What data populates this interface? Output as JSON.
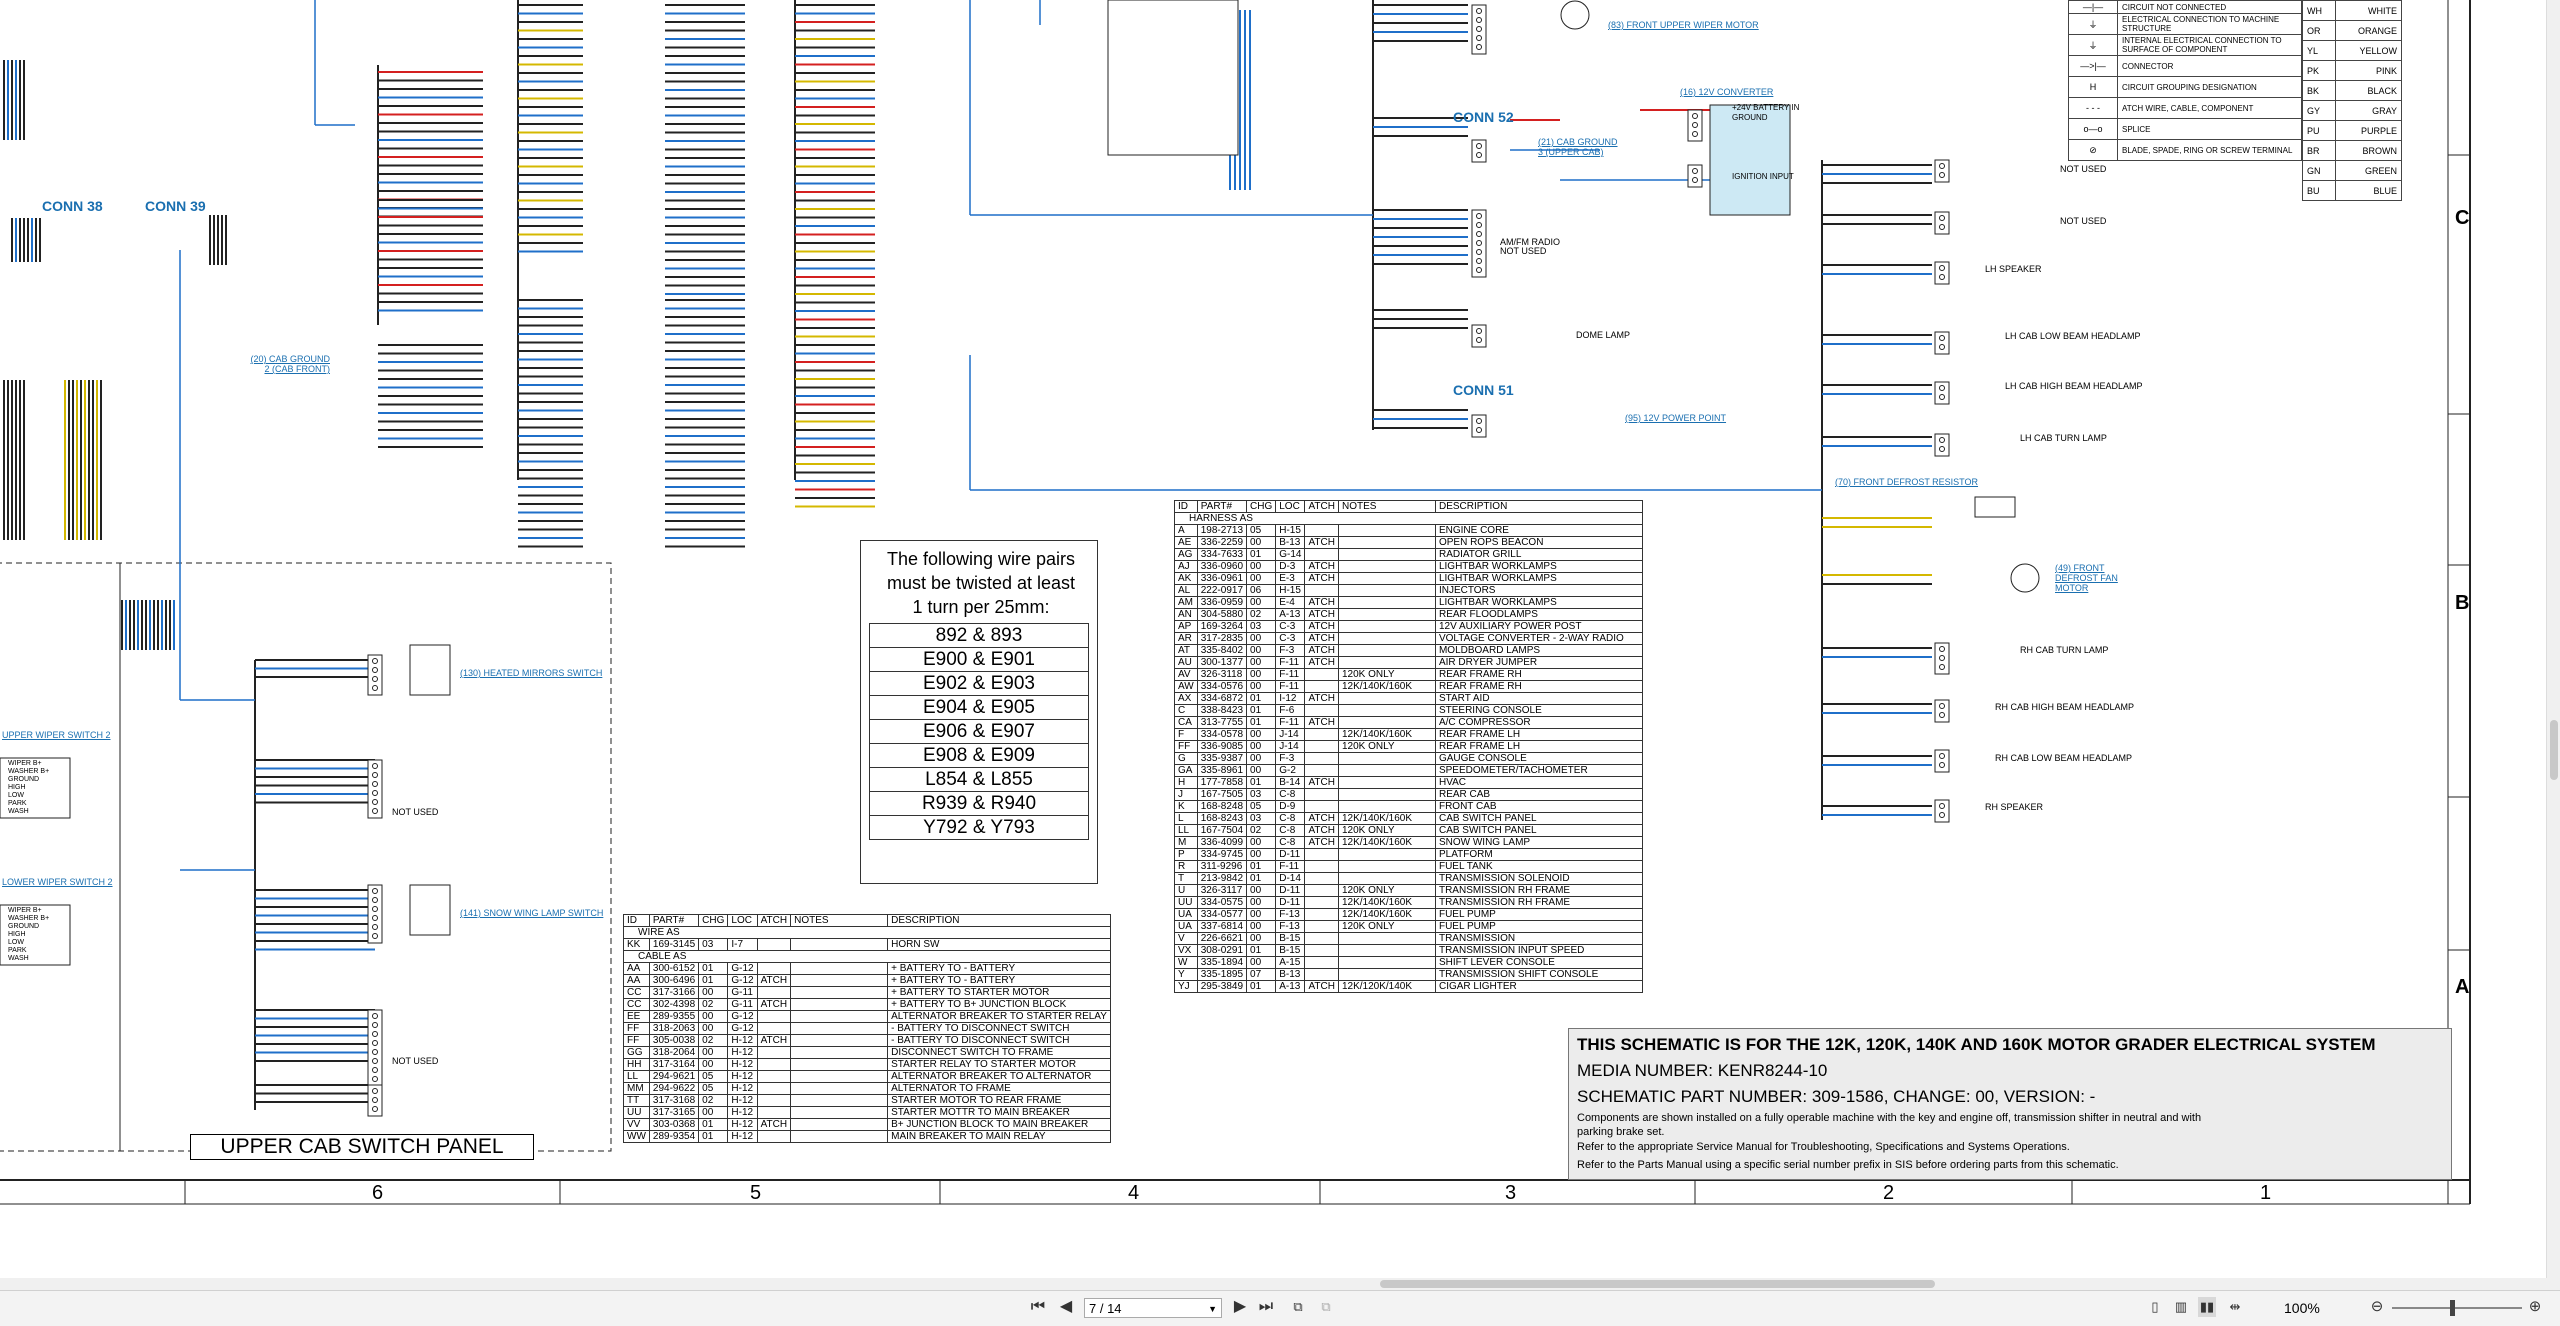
{
  "colors": {
    "wire_blue": "#1f6fc9",
    "wire_red": "#d42020",
    "wire_yellow": "#d4b800",
    "link": "#1a6fb0",
    "titleblock_bg": "#ececec",
    "wire_dark": "#222222"
  },
  "connectors": {
    "conn38": "CONN 38",
    "conn39": "CONN 39",
    "conn52": "CONN 52",
    "conn51": "CONN 51"
  },
  "component_links": {
    "front_upper_wiper": "(83) FRONT UPPER WIPER MOTOR",
    "cab_ground_2": "(20) CAB GROUND 2 (CAB FRONT)",
    "cab_ground_3": "(21) CAB GROUND 3 (UPPER CAB)",
    "converter": "(16) 12V CONVERTER",
    "power_point": "(95) 12V POWER POINT",
    "heated_mirrors": "(130) HEATED MIRRORS SWITCH",
    "snow_wing": "(141) SNOW WING LAMP SWITCH",
    "upper_wiper_sw": "UPPER WIPER SWITCH 2",
    "lower_wiper_sw": "LOWER WIPER SWITCH 2",
    "front_defrost_resistor": "(70) FRONT DEFROST RESISTOR",
    "front_defrost_fan": "(49) FRONT DEFROST FAN MOTOR"
  },
  "device_labels": {
    "battery_in": "+24V BATTERY IN",
    "ground": "GROUND",
    "ignition": "IGNITION INPUT",
    "am_radio": "AM/FM RADIO",
    "not_used": "NOT USED",
    "dome_lamp": "DOME LAMP",
    "lh_speaker": "LH SPEAKER",
    "lh_low_beam": "LH CAB LOW BEAM HEADLAMP",
    "lh_high_beam": "LH CAB HIGH BEAM HEADLAMP",
    "lh_turn": "LH CAB TURN LAMP",
    "rh_turn": "RH CAB TURN LAMP",
    "rh_high_beam": "RH CAB HIGH BEAM HEADLAMP",
    "rh_low_beam": "RH CAB LOW BEAM HEADLAMP",
    "rh_speaker": "RH SPEAKER",
    "motor": "MOTOR",
    "upper_cab_switch_panel": "UPPER CAB SWITCH PANEL"
  },
  "wiper_switch_pins": [
    "WIPER B+",
    "WASHER B+",
    "GROUND",
    "HIGH",
    "LOW",
    "PARK",
    "WASH"
  ],
  "twist_note": {
    "heading": "The following wire pairs must be twisted at least 1 turn per 25mm:",
    "pairs": [
      "892 & 893",
      "E900 & E901",
      "E902 & E903",
      "E904 & E905",
      "E906 & E907",
      "E908 & E909",
      "L854 & L855",
      "R939 & R940",
      "Y792 & Y793"
    ]
  },
  "legend_symbols": [
    "CIRCUIT NOT CONNECTED",
    "ELECTRICAL CONNECTION TO MACHINE STRUCTURE",
    "INTERNAL ELECTRICAL CONNECTION TO SURFACE OF COMPONENT",
    "CONNECTOR",
    "CIRCUIT GROUPING DESIGNATION",
    "ATCH WIRE, CABLE, COMPONENT",
    "SPLICE",
    "BLADE, SPADE, RING OR SCREW TERMINAL"
  ],
  "legend_colors": [
    {
      "code": "WH",
      "name": "WHITE"
    },
    {
      "code": "OR",
      "name": "ORANGE"
    },
    {
      "code": "YL",
      "name": "YELLOW"
    },
    {
      "code": "PK",
      "name": "PINK"
    },
    {
      "code": "BK",
      "name": "BLACK"
    },
    {
      "code": "GY",
      "name": "GRAY"
    },
    {
      "code": "PU",
      "name": "PURPLE"
    },
    {
      "code": "BR",
      "name": "BROWN"
    },
    {
      "code": "GN",
      "name": "GREEN"
    },
    {
      "code": "BU",
      "name": "BLUE"
    }
  ],
  "harness_table": {
    "headers": [
      "ID",
      "PART#",
      "CHG",
      "LOC",
      "ATCH",
      "NOTES",
      "DESCRIPTION"
    ],
    "section": "HARNESS AS",
    "rows": [
      [
        "A",
        "198-2713",
        "05",
        "H-15",
        "",
        "",
        "ENGINE CORE"
      ],
      [
        "AE",
        "336-2259",
        "00",
        "B-13",
        "ATCH",
        "",
        "OPEN ROPS BEACON"
      ],
      [
        "AG",
        "334-7633",
        "01",
        "G-14",
        "",
        "",
        "RADIATOR GRILL"
      ],
      [
        "AJ",
        "336-0960",
        "00",
        "D-3",
        "ATCH",
        "",
        "LIGHTBAR WORKLAMPS"
      ],
      [
        "AK",
        "336-0961",
        "00",
        "E-3",
        "ATCH",
        "",
        "LIGHTBAR WORKLAMPS"
      ],
      [
        "AL",
        "222-0917",
        "06",
        "H-15",
        "",
        "",
        "INJECTORS"
      ],
      [
        "AM",
        "336-0959",
        "00",
        "E-4",
        "ATCH",
        "",
        "LIGHTBAR WORKLAMPS"
      ],
      [
        "AN",
        "304-5880",
        "02",
        "A-13",
        "ATCH",
        "",
        "REAR FLOODLAMPS"
      ],
      [
        "AP",
        "169-3264",
        "03",
        "C-3",
        "ATCH",
        "",
        "12V AUXILIARY POWER POST"
      ],
      [
        "AR",
        "317-2835",
        "00",
        "C-3",
        "ATCH",
        "",
        "VOLTAGE CONVERTER - 2-WAY RADIO"
      ],
      [
        "AT",
        "335-8402",
        "00",
        "F-3",
        "ATCH",
        "",
        "MOLDBOARD LAMPS"
      ],
      [
        "AU",
        "300-1377",
        "00",
        "F-11",
        "ATCH",
        "",
        "AIR DRYER JUMPER"
      ],
      [
        "AV",
        "326-3118",
        "00",
        "F-11",
        "",
        "120K ONLY",
        "REAR FRAME RH"
      ],
      [
        "AW",
        "334-0576",
        "00",
        "F-11",
        "",
        "12K/140K/160K",
        "REAR FRAME RH"
      ],
      [
        "AX",
        "334-6872",
        "01",
        "I-12",
        "ATCH",
        "",
        "START AID"
      ],
      [
        "C",
        "338-8423",
        "01",
        "F-6",
        "",
        "",
        "STEERING CONSOLE"
      ],
      [
        "CA",
        "313-7755",
        "01",
        "F-11",
        "ATCH",
        "",
        "A/C COMPRESSOR"
      ],
      [
        "F",
        "334-0578",
        "00",
        "J-14",
        "",
        "12K/140K/160K",
        "REAR FRAME LH"
      ],
      [
        "FF",
        "336-9085",
        "00",
        "J-14",
        "",
        "120K ONLY",
        "REAR FRAME LH"
      ],
      [
        "G",
        "335-9387",
        "00",
        "F-3",
        "",
        "",
        "GAUGE CONSOLE"
      ],
      [
        "GA",
        "335-8961",
        "00",
        "G-2",
        "",
        "",
        "SPEEDOMETER/TACHOMETER"
      ],
      [
        "H",
        "177-7858",
        "01",
        "B-14",
        "ATCH",
        "",
        "HVAC"
      ],
      [
        "J",
        "167-7505",
        "03",
        "C-8",
        "",
        "",
        "REAR CAB"
      ],
      [
        "K",
        "168-8248",
        "05",
        "D-9",
        "",
        "",
        "FRONT CAB"
      ],
      [
        "L",
        "168-8243",
        "03",
        "C-8",
        "ATCH",
        "12K/140K/160K",
        "CAB SWITCH PANEL"
      ],
      [
        "LL",
        "167-7504",
        "02",
        "C-8",
        "ATCH",
        "120K ONLY",
        "CAB SWITCH PANEL"
      ],
      [
        "M",
        "336-4099",
        "00",
        "C-8",
        "ATCH",
        "12K/140K/160K",
        "SNOW WING LAMP"
      ],
      [
        "P",
        "334-9745",
        "00",
        "D-11",
        "",
        "",
        "PLATFORM"
      ],
      [
        "R",
        "311-9296",
        "01",
        "F-11",
        "",
        "",
        "FUEL TANK"
      ],
      [
        "T",
        "213-9842",
        "01",
        "D-14",
        "",
        "",
        "TRANSMISSION SOLENOID"
      ],
      [
        "U",
        "326-3117",
        "00",
        "D-11",
        "",
        "120K ONLY",
        "TRANSMISSION RH FRAME"
      ],
      [
        "UU",
        "334-0575",
        "00",
        "D-11",
        "",
        "12K/140K/160K",
        "TRANSMISSION RH FRAME"
      ],
      [
        "UA",
        "334-0577",
        "00",
        "F-13",
        "",
        "12K/140K/160K",
        "FUEL PUMP"
      ],
      [
        "UA",
        "337-6814",
        "00",
        "F-13",
        "",
        "120K ONLY",
        "FUEL PUMP"
      ],
      [
        "V",
        "226-6621",
        "00",
        "B-15",
        "",
        "",
        "TRANSMISSION"
      ],
      [
        "VX",
        "308-0291",
        "01",
        "B-15",
        "",
        "",
        "TRANSMISSION INPUT SPEED"
      ],
      [
        "W",
        "335-1894",
        "00",
        "A-15",
        "",
        "",
        "SHIFT LEVER CONSOLE"
      ],
      [
        "Y",
        "335-1895",
        "07",
        "B-13",
        "",
        "",
        "TRANSMISSION SHIFT CONSOLE"
      ],
      [
        "YJ",
        "295-3849",
        "01",
        "A-13",
        "ATCH",
        "12K/120K/140K",
        "CIGAR LIGHTER"
      ]
    ]
  },
  "wire_table": {
    "headers": [
      "ID",
      "PART#",
      "CHG",
      "LOC",
      "ATCH",
      "NOTES",
      "DESCRIPTION"
    ],
    "section1": "WIRE AS",
    "section2": "CABLE AS",
    "rows1": [
      [
        "KK",
        "169-3145",
        "03",
        "I-7",
        "",
        "",
        "HORN SW"
      ]
    ],
    "rows2": [
      [
        "AA",
        "300-6152",
        "01",
        "G-12",
        "",
        "",
        "+ BATTERY TO - BATTERY"
      ],
      [
        "AA",
        "300-6496",
        "01",
        "G-12",
        "ATCH",
        "",
        "+ BATTERY TO - BATTERY"
      ],
      [
        "CC",
        "317-3166",
        "00",
        "G-11",
        "",
        "",
        "+ BATTERY TO STARTER MOTOR"
      ],
      [
        "CC",
        "302-4398",
        "02",
        "G-11",
        "ATCH",
        "",
        "+ BATTERY TO B+ JUNCTION BLOCK"
      ],
      [
        "EE",
        "289-9355",
        "00",
        "G-12",
        "",
        "",
        "ALTERNATOR BREAKER TO STARTER RELAY"
      ],
      [
        "FF",
        "318-2063",
        "00",
        "G-12",
        "",
        "",
        "- BATTERY TO DISCONNECT SWITCH"
      ],
      [
        "FF",
        "305-0038",
        "02",
        "H-12",
        "ATCH",
        "",
        "- BATTERY TO DISCONNECT SWITCH"
      ],
      [
        "GG",
        "318-2064",
        "00",
        "H-12",
        "",
        "",
        "DISCONNECT SWITCH TO FRAME"
      ],
      [
        "HH",
        "317-3164",
        "00",
        "H-12",
        "",
        "",
        "STARTER RELAY TO STARTER MOTOR"
      ],
      [
        "LL",
        "294-9621",
        "05",
        "H-12",
        "",
        "",
        "ALTERNATOR BREAKER TO ALTERNATOR"
      ],
      [
        "MM",
        "294-9622",
        "05",
        "H-12",
        "",
        "",
        "ALTERNATOR TO FRAME"
      ],
      [
        "TT",
        "317-3168",
        "02",
        "H-12",
        "",
        "",
        "STARTER MOTOR TO REAR FRAME"
      ],
      [
        "UU",
        "317-3165",
        "00",
        "H-12",
        "",
        "",
        "STARTER MOTTR TO MAIN BREAKER"
      ],
      [
        "VV",
        "303-0368",
        "01",
        "H-12",
        "ATCH",
        "",
        "B+ JUNCTION BLOCK TO MAIN BREAKER"
      ],
      [
        "WW",
        "289-9354",
        "01",
        "H-12",
        "",
        "",
        "MAIN BREAKER TO MAIN RELAY"
      ]
    ]
  },
  "title_block": {
    "line1": "THIS SCHEMATIC IS FOR THE 12K, 120K, 140K AND 160K MOTOR GRADER ELECTRICAL SYSTEM",
    "line2": "MEDIA NUMBER: KENR8244-10",
    "line3": "SCHEMATIC PART NUMBER: 309-1586, CHANGE: 00, VERSION: -",
    "line4": "Components are shown installed on a fully operable machine with the key and engine off, transmission shifter in neutral and with parking brake set.",
    "line5": "Refer to the appropriate Service Manual for Troubleshooting, Specifications and Systems Operations.",
    "line6": "Refer to the Parts Manual using a specific serial number prefix in SIS before ordering parts from this schematic."
  },
  "zone_columns": [
    "6",
    "5",
    "4",
    "3",
    "2",
    "1"
  ],
  "zone_rows": [
    "C",
    "B",
    "A"
  ],
  "viewer": {
    "page_field": "7 / 14",
    "zoom": "100%"
  }
}
